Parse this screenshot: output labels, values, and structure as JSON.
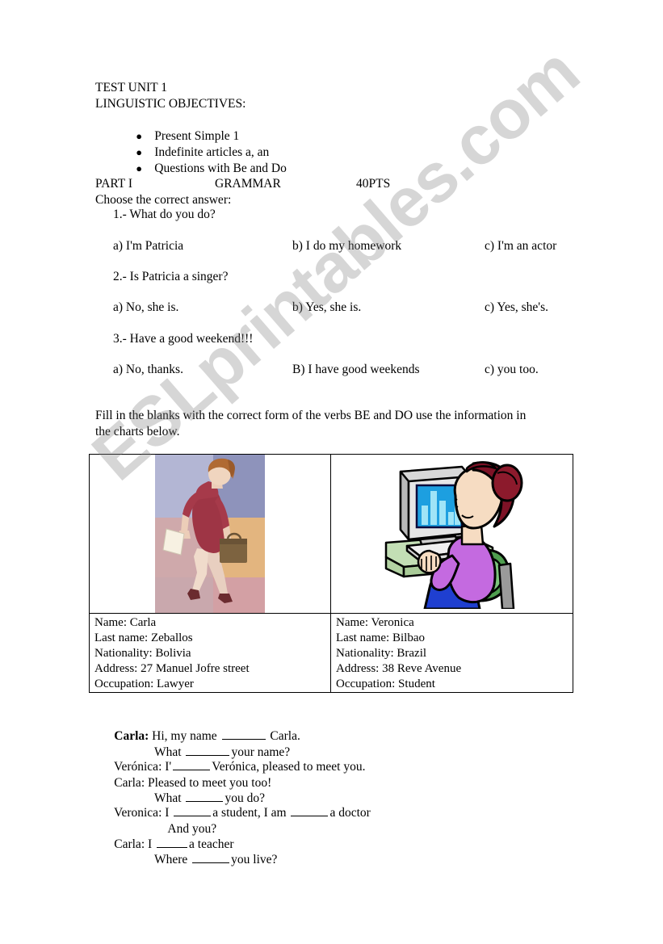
{
  "document": {
    "title": "TEST UNIT 1",
    "objectives_label": "LINGUISTIC OBJECTIVES:",
    "objectives": [
      "Present Simple 1",
      "Indefinite articles a, an",
      "Questions with Be and Do"
    ],
    "watermark": "ESLprintables.com"
  },
  "part_one": {
    "part_label": "PART I",
    "section_label": "GRAMMAR",
    "points_label": "40PTS",
    "instruction": "Choose the correct answer:",
    "questions": [
      {
        "number": "1.- What do you do?",
        "options": {
          "a": "a) I'm Patricia",
          "b": "b) I do my homework",
          "c": "c) I'm an actor"
        }
      },
      {
        "number": "2.- Is Patricia a singer?",
        "options": {
          "a": "a) No, she is.",
          "b": "b) Yes, she is.",
          "c": "c) Yes, she's."
        }
      },
      {
        "number": "3.- Have a good weekend!!!",
        "options": {
          "a": "a) No, thanks.",
          "b": "B) I have good weekends",
          "c": "c) you too."
        }
      }
    ]
  },
  "fill_in": {
    "instruction_line_1": "Fill in the blanks with the correct form of the verbs BE and DO use the information in",
    "instruction_line_2": "the charts below."
  },
  "info_cards": {
    "left": {
      "image_name": "businesswoman-walking-illustration",
      "fields": [
        "Name: Carla",
        "Last name: Zeballos",
        "Nationality: Bolivia",
        "Address: 27 Manuel Jofre street",
        "Occupation: Lawyer"
      ]
    },
    "right": {
      "image_name": "woman-at-computer-illustration",
      "fields": [
        "Name: Veronica",
        "Last name: Bilbao",
        "Nationality: Brazil",
        "Address: 38 Reve Avenue",
        "Occupation: Student"
      ]
    }
  },
  "dialogue": {
    "lines": [
      {
        "speaker": "Carla:",
        "bold_speaker": true,
        "before": " Hi, my name ",
        "blank": "bl-6",
        "after": " Carla."
      },
      {
        "speaker": "",
        "bold_speaker": false,
        "before": "What ",
        "blank": "bl-6",
        "after": "your name?"
      },
      {
        "speaker": "Verónica:",
        "bold_speaker": false,
        "before": " I'",
        "blank": "bl-5",
        "after": "Verónica, pleased to meet you."
      },
      {
        "speaker": "Carla:",
        "bold_speaker": false,
        "before": " Pleased to meet you too!",
        "blank": "",
        "after": ""
      },
      {
        "speaker": "",
        "bold_speaker": false,
        "before": "What ",
        "blank": "bl-5",
        "after": "you do?"
      },
      {
        "speaker": "Veronica:",
        "bold_speaker": false,
        "before": " I ",
        "blank": "bl-5",
        "after": "a student, I am ",
        "blank2": "bl-5",
        "after2": "a doctor"
      },
      {
        "speaker": "",
        "bold_speaker": false,
        "before": "And you?",
        "blank": "",
        "after": ""
      },
      {
        "speaker": "Carla:",
        "bold_speaker": false,
        "before": " I ",
        "blank": "bl-4",
        "after": "a teacher"
      },
      {
        "speaker": "",
        "bold_speaker": false,
        "before": "Where ",
        "blank": "bl-5",
        "after": "you live?"
      }
    ]
  },
  "colors": {
    "text": "#000000",
    "page_background": "#ffffff",
    "table_border": "#000000",
    "watermark": "#828282"
  }
}
